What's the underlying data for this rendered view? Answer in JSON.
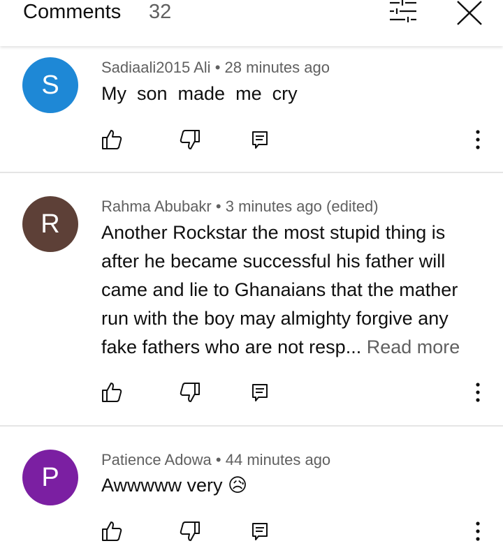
{
  "header": {
    "title": "Comments",
    "count": "32"
  },
  "comments": [
    {
      "avatar_letter": "S",
      "avatar_color": "#1e88d6",
      "author": "Sadiaali2015 Ali",
      "time": "28 minutes ago",
      "text": "My  son  made  me  cry"
    },
    {
      "avatar_letter": "R",
      "avatar_color": "#5d4037",
      "author": "Rahma Abubakr",
      "time": "3 minutes ago (edited)",
      "text": "Another Rockstar the most stupid thing is after he became successful his father will came and lie to Ghanaians that the mather run with the boy may almighty forgive any fake fathers who are not resp...",
      "read_more": "Read more"
    },
    {
      "avatar_letter": "P",
      "avatar_color": "#7b1fa2",
      "author": "Patience Adowa",
      "time": "44 minutes ago",
      "text": "Awwwww very",
      "emoji": "😥"
    }
  ],
  "separator": "•",
  "icons": [
    "sliders-icon",
    "close-icon",
    "like-icon",
    "dislike-icon",
    "reply-icon",
    "more-vert-icon"
  ]
}
